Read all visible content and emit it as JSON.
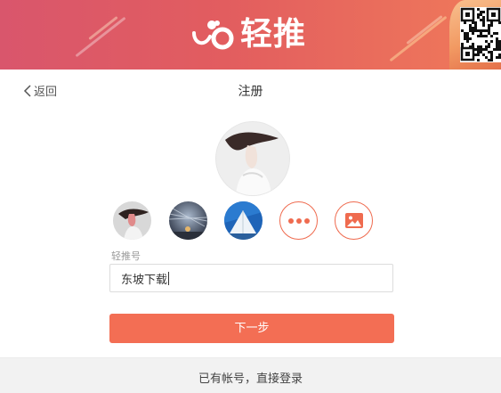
{
  "header": {
    "brand_name": "轻推",
    "logo_icon": "qingtui-logo-icon",
    "qr_icon": "qr-code-icon",
    "colors": {
      "gradient_start": "#d9566c",
      "gradient_end": "#f07a5a"
    }
  },
  "nav": {
    "back_label": "返回",
    "back_icon": "chevron-left-icon",
    "title": "注册"
  },
  "avatar": {
    "options": [
      {
        "name": "avatar-option-1",
        "icon": "portrait-photo"
      },
      {
        "name": "avatar-option-2",
        "icon": "night-sky-photo"
      },
      {
        "name": "avatar-option-3",
        "icon": "blue-triangle-photo"
      },
      {
        "name": "more-avatars",
        "icon": "more-dots-icon"
      },
      {
        "name": "upload-image",
        "icon": "image-icon"
      }
    ]
  },
  "form": {
    "account_label": "轻推号",
    "account_value": "东坡下载",
    "next_label": "下一步"
  },
  "footer": {
    "login_link": "已有帐号，直接登录"
  },
  "colors": {
    "accent": "#f36e54"
  }
}
